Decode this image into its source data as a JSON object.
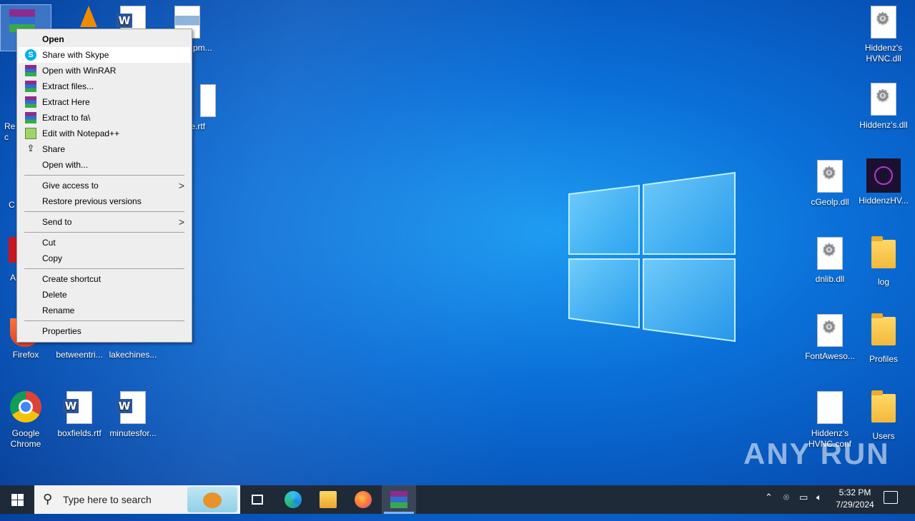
{
  "desktop": {
    "left_icons": [
      {
        "label": "Firefox"
      },
      {
        "label": "betweentri..."
      },
      {
        "label": "lakechines..."
      },
      {
        "label": "Google Chrome"
      },
      {
        "label": "boxfields.rtf"
      },
      {
        "label": "minutesfor..."
      }
    ],
    "partial_labels": {
      "rtf_behind_menu": "dle.rtf",
      "png_behind_menu": "pm...",
      "recycle_partial": "Rec",
      "partial_c": "C",
      "partial_a": "A"
    },
    "right_icons": [
      {
        "label": "Hiddenz's HVNC.dll",
        "type": "dll"
      },
      {
        "label": "Hiddenz's.dll",
        "type": "dll"
      },
      {
        "label": "cGeolp.dll",
        "type": "dll"
      },
      {
        "label": "HiddenzHV...",
        "type": "app"
      },
      {
        "label": "dnlib.dll",
        "type": "dll"
      },
      {
        "label": "log",
        "type": "folder"
      },
      {
        "label": "FontAweso...",
        "type": "dll"
      },
      {
        "label": "Profiles",
        "type": "folder"
      },
      {
        "label": "Hiddenz's HVNC.conf",
        "type": "file"
      },
      {
        "label": "Users",
        "type": "folder"
      }
    ]
  },
  "context_menu": {
    "items": [
      {
        "label": "Open",
        "bold": true
      },
      {
        "label": "Share with Skype",
        "icon": "skype-icon",
        "highlighted": true
      },
      {
        "label": "Open with WinRAR",
        "icon": "winrar-icon"
      },
      {
        "label": "Extract files...",
        "icon": "winrar-icon"
      },
      {
        "label": "Extract Here",
        "icon": "winrar-icon"
      },
      {
        "label": "Extract to fa\\",
        "icon": "winrar-icon"
      },
      {
        "label": "Edit with Notepad++",
        "icon": "notepadpp-icon"
      },
      {
        "label": "Share",
        "icon": "share-icon"
      },
      {
        "label": "Open with..."
      },
      {
        "label": "Give access to",
        "submenu": true
      },
      {
        "label": "Restore previous versions"
      },
      {
        "label": "Send to",
        "submenu": true
      },
      {
        "label": "Cut"
      },
      {
        "label": "Copy"
      },
      {
        "label": "Create shortcut"
      },
      {
        "label": "Delete"
      },
      {
        "label": "Rename"
      },
      {
        "label": "Properties"
      }
    ]
  },
  "taskbar": {
    "search_placeholder": "Type here to search",
    "pinned": [
      "task-view-icon",
      "edge-icon",
      "file-explorer-icon",
      "firefox-icon",
      "winrar-icon"
    ],
    "clock_time": "5:32 PM",
    "clock_date": "7/29/2024"
  },
  "watermark": "ANY RUN",
  "colors": {
    "accent": "#0a6fd8",
    "taskbar": "#1f2a38",
    "menu_bg": "#eeeeee"
  }
}
